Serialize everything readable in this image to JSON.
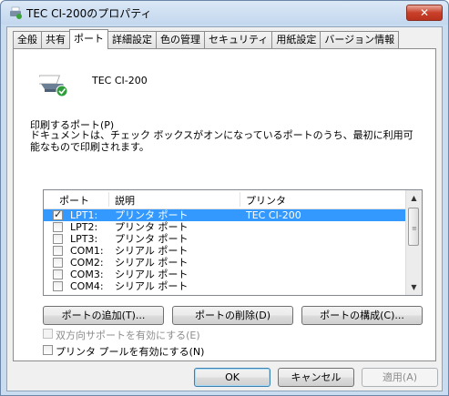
{
  "window": {
    "title": "TEC CI-200のプロパティ",
    "close_glyph": "✕"
  },
  "tabs": [
    {
      "label": "全般"
    },
    {
      "label": "共有"
    },
    {
      "label": "ポート"
    },
    {
      "label": "詳細設定"
    },
    {
      "label": "色の管理"
    },
    {
      "label": "セキュリティ"
    },
    {
      "label": "用紙設定"
    },
    {
      "label": "バージョン情報"
    }
  ],
  "active_tab": "ポート",
  "printer": {
    "name": "TEC CI-200",
    "icon": "printer-check-icon"
  },
  "ports_section": {
    "label": "印刷するポート(P)",
    "description": "ドキュメントは、チェック ボックスがオンになっているポートのうち、最初に利用可能なもので印刷されます。"
  },
  "port_list": {
    "headers": {
      "port": "ポート",
      "desc": "説明",
      "printer": "プリンタ"
    },
    "rows": [
      {
        "port": "LPT1:",
        "desc": "プリンタ ポート",
        "printer": "TEC CI-200",
        "checked": true,
        "selected": true
      },
      {
        "port": "LPT2:",
        "desc": "プリンタ ポート",
        "printer": "",
        "checked": false,
        "selected": false
      },
      {
        "port": "LPT3:",
        "desc": "プリンタ ポート",
        "printer": "",
        "checked": false,
        "selected": false
      },
      {
        "port": "COM1:",
        "desc": "シリアル ポート",
        "printer": "",
        "checked": false,
        "selected": false
      },
      {
        "port": "COM2:",
        "desc": "シリアル ポート",
        "printer": "",
        "checked": false,
        "selected": false
      },
      {
        "port": "COM3:",
        "desc": "シリアル ポート",
        "printer": "",
        "checked": false,
        "selected": false
      },
      {
        "port": "COM4:",
        "desc": "シリアル ポート",
        "printer": "",
        "checked": false,
        "selected": false
      }
    ],
    "selection_color": "#3399ff"
  },
  "port_buttons": {
    "add": "ポートの追加(T)...",
    "delete": "ポートの削除(D)",
    "configure": "ポートの構成(C)..."
  },
  "options": {
    "bidirectional": {
      "label": "双方向サポートを有効にする(E)",
      "checked": false,
      "enabled": false
    },
    "pooling": {
      "label": "プリンタ プールを有効にする(N)",
      "checked": false,
      "enabled": true
    }
  },
  "dialog_buttons": {
    "ok": "OK",
    "cancel": "キャンセル",
    "apply": "適用(A)"
  }
}
